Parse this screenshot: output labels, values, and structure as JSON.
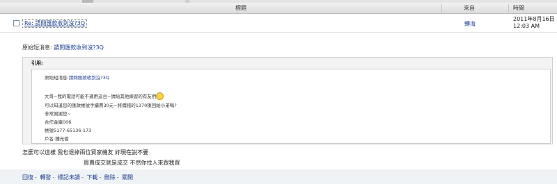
{
  "header": {
    "subject": "標題",
    "from": "來自",
    "time": "時間"
  },
  "message": {
    "subject": "Re: 請問匯款收到沒?3Q",
    "from": "轉海",
    "date": "2011年8月16日",
    "clock": "12:03 AM"
  },
  "original": {
    "label": "原始短消息:",
    "link": "請問匯款收到沒?3Q"
  },
  "quote": {
    "title": "引用:",
    "label": "原始短消息:",
    "link": "請問匯款收到沒?3Q",
    "lines": [
      "大哥~我的電話可能不適用這台~請給其他練習的有友們",
      "可以知道您的匯款帳號手續費30元~將價錢的1370匯回給小弟嗎?",
      "非常謝謝您~",
      "合作金庫006",
      "帳號5177-6513­6-173",
      "戶名:鍾光倫"
    ]
  },
  "reply": {
    "line1": "怎麼可以這樣  我也退掉兩位買家機友  妳現在說不要",
    "line2": "買賣成交就是成交     不然你找人來跟我買"
  },
  "actions": [
    "回復",
    "轉發",
    "標記未讀",
    "下載",
    "刪除",
    "關閉"
  ]
}
